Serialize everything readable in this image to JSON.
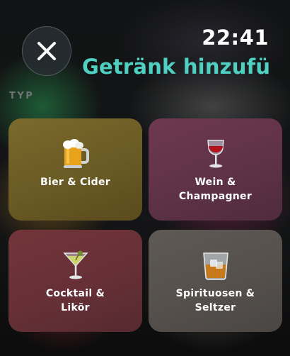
{
  "status": {
    "time": "22:41"
  },
  "header": {
    "title": "Getränk hinzufüg",
    "close_icon": "close-icon"
  },
  "section": {
    "label": "TYP"
  },
  "tiles": [
    {
      "label": "Bier & Cider",
      "icon": "beer-mug-icon",
      "color": "#6a5a24"
    },
    {
      "label": "Wein &\nChampagner",
      "icon": "wine-glass-icon",
      "color": "#5f3247"
    },
    {
      "label": "Cocktail &\nLikör",
      "icon": "cocktail-glass-icon",
      "color": "#663036"
    },
    {
      "label": "Spirituosen &\nSeltzer",
      "icon": "tumbler-glass-icon",
      "color": "#55504c"
    }
  ],
  "colors": {
    "accent": "#4fd0c2",
    "section_label": "#6f7577"
  }
}
